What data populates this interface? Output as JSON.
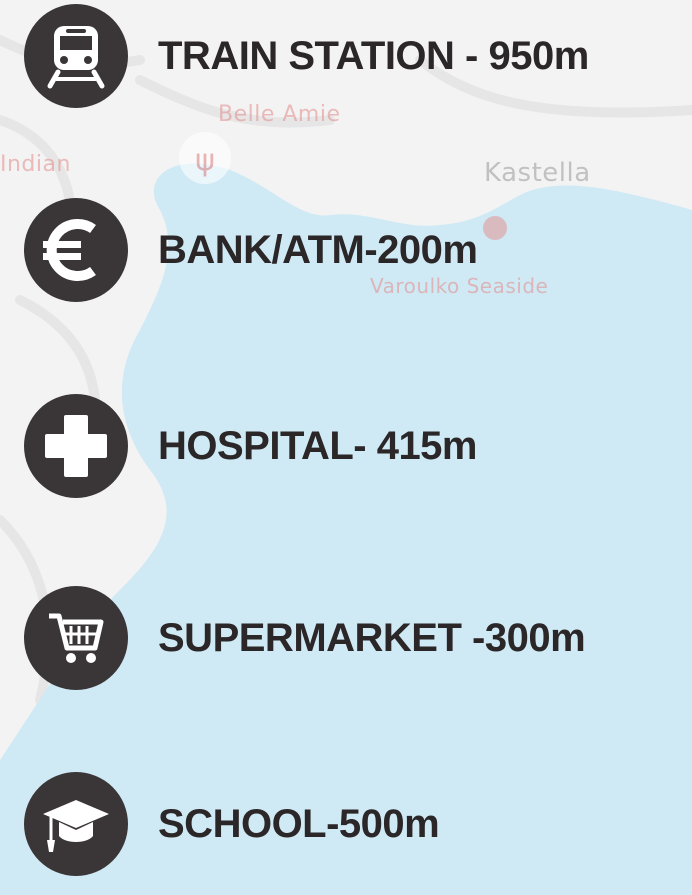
{
  "map": {
    "labels": {
      "restaurant": "Belle Amie",
      "area": "Kastella",
      "indian": "Indian",
      "seaside": "Varoulko Seaside"
    },
    "colors": {
      "land": "#f3f3f3",
      "sea": "#cfeaf5",
      "poi_red": "#e38a8a",
      "place_grey": "#9a9a9a"
    }
  },
  "amenities": [
    {
      "icon": "train-icon",
      "label": "TRAIN STATION - 950m"
    },
    {
      "icon": "euro-icon",
      "label": "BANK/ATM-200m"
    },
    {
      "icon": "plus-icon",
      "label": "HOSPITAL- 415m"
    },
    {
      "icon": "cart-icon",
      "label": "SUPERMARKET -300m"
    },
    {
      "icon": "graduation-cap-icon",
      "label": "SCHOOL-500m"
    }
  ],
  "colors": {
    "icon_circle": "#3a3637",
    "text": "#2b2627"
  }
}
